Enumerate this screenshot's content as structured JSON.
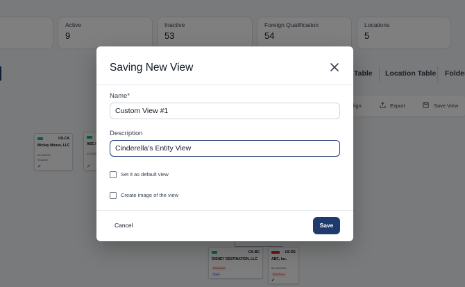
{
  "stats": [
    {
      "label": "",
      "value": ""
    },
    {
      "label": "Active",
      "value": "9"
    },
    {
      "label": "Inactive",
      "value": "53"
    },
    {
      "label": "Foreign Qualification",
      "value": "54"
    },
    {
      "label": "Locations",
      "value": "5"
    }
  ],
  "view_tabs": [
    "Table",
    "Location Table",
    "Folder"
  ],
  "toolbar": {
    "align": "Align",
    "export": "Export",
    "save_view": "Save View"
  },
  "nodes": [
    {
      "code": "US-CA",
      "name": "Mickey Mouse, LLC",
      "id": "AS-4049/15",
      "status": "Resolved"
    },
    {
      "code": "",
      "name": "ABC I",
      "id": "AS-4049/",
      "status": ""
    },
    {
      "code": "CA-BC",
      "name": "DISNEY DESTINATION, LLC",
      "chip1": "Filed Soon",
      "chip2": "Trade"
    },
    {
      "code": "US-DE",
      "name": "ABC, Inc.",
      "id": "AS-4049/15/0",
      "chip1": "Filed Soon"
    }
  ],
  "modal": {
    "title": "Saving New View",
    "name_label": "Name*",
    "name_value": "Custom View #1",
    "description_label": "Description",
    "description_value": "Cinderella's Entity View",
    "default_label": "Set it as default view",
    "default_checked": false,
    "image_label": "Create image of the view",
    "image_checked": false,
    "cancel_label": "Cancel",
    "save_label": "Save"
  },
  "colors": {
    "primary": "#1e3a6e",
    "overlay": "rgba(0,0,0,0.5)",
    "green_tag": "#10b981",
    "red_tag": "#dc2626"
  }
}
